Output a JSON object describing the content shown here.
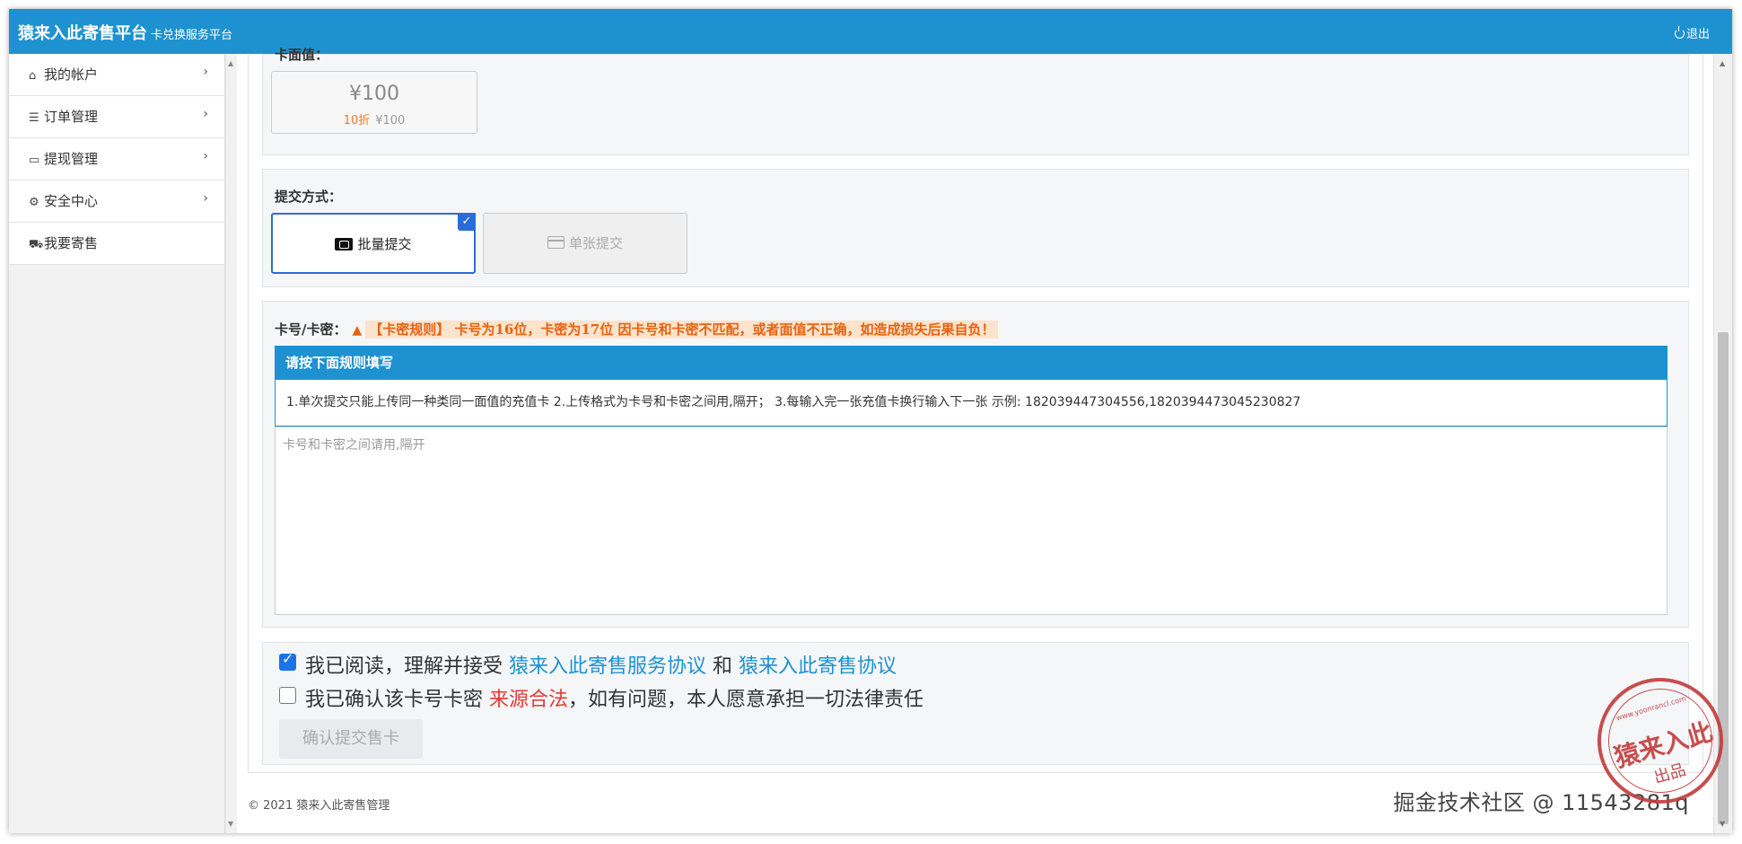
{
  "header": {
    "brand": "猿来入此寄售平台",
    "subtitle": "卡兑换服务平台",
    "logout": "退出"
  },
  "sidebar": {
    "items": [
      {
        "icon": "home-icon",
        "label": "我的帐户",
        "has_chevron": true
      },
      {
        "icon": "list-icon",
        "label": "订单管理",
        "has_chevron": true
      },
      {
        "icon": "credit-card-icon",
        "label": "提现管理",
        "has_chevron": true
      },
      {
        "icon": "gear-icon",
        "label": "安全中心",
        "has_chevron": true
      },
      {
        "icon": "cart-icon",
        "label": "我要寄售",
        "has_chevron": false
      }
    ]
  },
  "face_value": {
    "label": "卡面值：",
    "card": {
      "amount": "¥100",
      "discount": "10折",
      "price": "¥100"
    }
  },
  "submit_mode": {
    "label": "提交方式：",
    "options": [
      {
        "label": "批量提交",
        "selected": true
      },
      {
        "label": "单张提交",
        "selected": false
      }
    ]
  },
  "card_input": {
    "label": "卡号/卡密：",
    "warning": "【卡密规则】 卡号为16位，卡密为17位 因卡号和卡密不匹配，或者面值不正确，如造成损失后果自负！",
    "rules_title": "请按下面规则填写",
    "rules_text": "1.单次提交只能上传同一种类同一面值的充值卡 2.上传格式为卡号和卡密之间用,隔开；  3.每输入完一张充值卡换行输入下一张 示例: 182039447304556,1820394473045230827",
    "placeholder": "卡号和卡密之间请用,隔开",
    "value": ""
  },
  "agreements": {
    "line1": {
      "checked": true,
      "prefix": "我已阅读，理解并接受 ",
      "link1": "猿来入此寄售服务协议",
      "mid": " 和 ",
      "link2": "猿来入此寄售协议"
    },
    "line2": {
      "checked": false,
      "prefix": "我已确认该卡号卡密 ",
      "highlight": "来源合法",
      "suffix": "，如有问题，本人愿意承担一切法律责任"
    }
  },
  "submit_button": "确认提交售卡",
  "footer": {
    "copyright": "© 2021 猿来入此寄售管理",
    "watermark": "掘金技术社区 @ 11543281q"
  },
  "stamp": {
    "text": "猿来入此",
    "sub": "出品",
    "url": "www.yoonrancl.com"
  },
  "colors": {
    "primary": "#1e92d0",
    "warning": "#e8620f",
    "checkbox": "#1a73e8",
    "danger": "#e53935"
  }
}
